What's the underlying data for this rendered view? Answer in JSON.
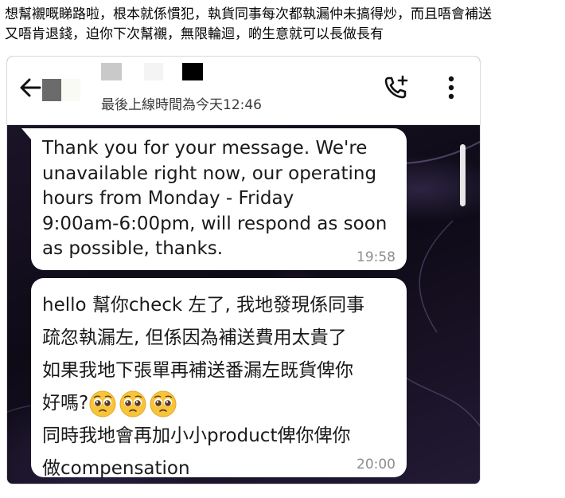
{
  "post": {
    "caption_line1": "想幫襯嘅睇路啦，根本就係慣犯，執貨同事每次都執漏仲未搞得炒，而且唔會補送",
    "caption_line2": "又唔肯退錢，迫你下次幫襯，無限輪迴，啲生意就可以長做長有"
  },
  "chat_header": {
    "last_seen": "最後上線時間為今天12:46",
    "icons": [
      "back-arrow-icon",
      "add-call-icon",
      "more-vert-icon"
    ]
  },
  "messages": [
    {
      "text": "Thank you for your message. We're\nunavailable right now, our operating\nhours from Monday - Friday\n9:00am-6:00pm, will respond as soon\nas possible, thanks.",
      "time": "19:58"
    },
    {
      "text_line1": "hello 幫你check 左了, 我地發現係同事",
      "text_line2": "疏忽執漏左, 但係因為補送費用太貴了",
      "text_line3": "如果我地下張單再補送番漏左既貨俾你",
      "text_line4": "好嗎?",
      "emoji": "pleading-face-icon",
      "emoji_count": 3,
      "text_line5": "同時我地會再加小小product俾你俾你",
      "text_line6": "做compensation",
      "time": "20:00"
    }
  ],
  "colors": {
    "header_bg": "#ffffff",
    "bubble_bg": "#ffffff",
    "chat_bg": "#140d1e",
    "time_text": "#8e8e8e"
  }
}
